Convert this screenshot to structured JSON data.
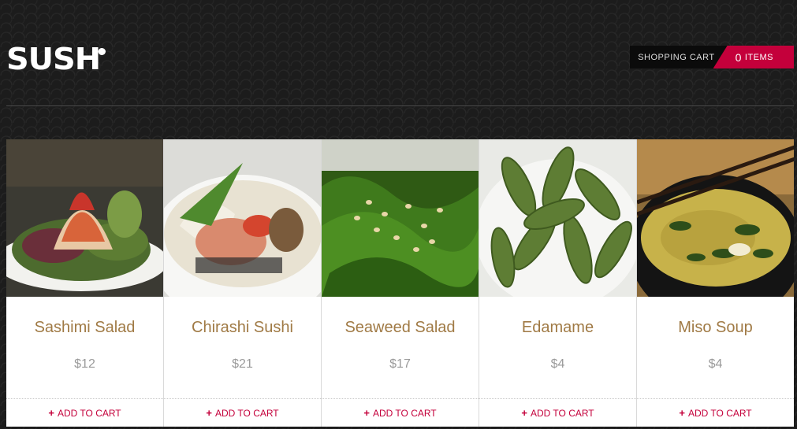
{
  "brand": {
    "logo_text": "SUSHi"
  },
  "cart": {
    "label": "SHOPPING CART",
    "count": "0",
    "items_label": "ITEMS"
  },
  "products": [
    {
      "name": "Sashimi Salad",
      "price": "$12",
      "add_label": "ADD TO CART",
      "image": "sashimi-salad-photo"
    },
    {
      "name": "Chirashi Sushi",
      "price": "$21",
      "add_label": "ADD TO CART",
      "image": "chirashi-sushi-photo"
    },
    {
      "name": "Seaweed Salad",
      "price": "$17",
      "add_label": "ADD TO CART",
      "image": "seaweed-salad-photo"
    },
    {
      "name": "Edamame",
      "price": "$4",
      "add_label": "ADD TO CART",
      "image": "edamame-photo"
    },
    {
      "name": "Miso Soup",
      "price": "$4",
      "add_label": "ADD TO CART",
      "image": "miso-soup-photo"
    }
  ],
  "colors": {
    "accent": "#c4003b",
    "product_name": "#a07a45",
    "price": "#9a9a9a",
    "background": "#1c1c1c"
  }
}
